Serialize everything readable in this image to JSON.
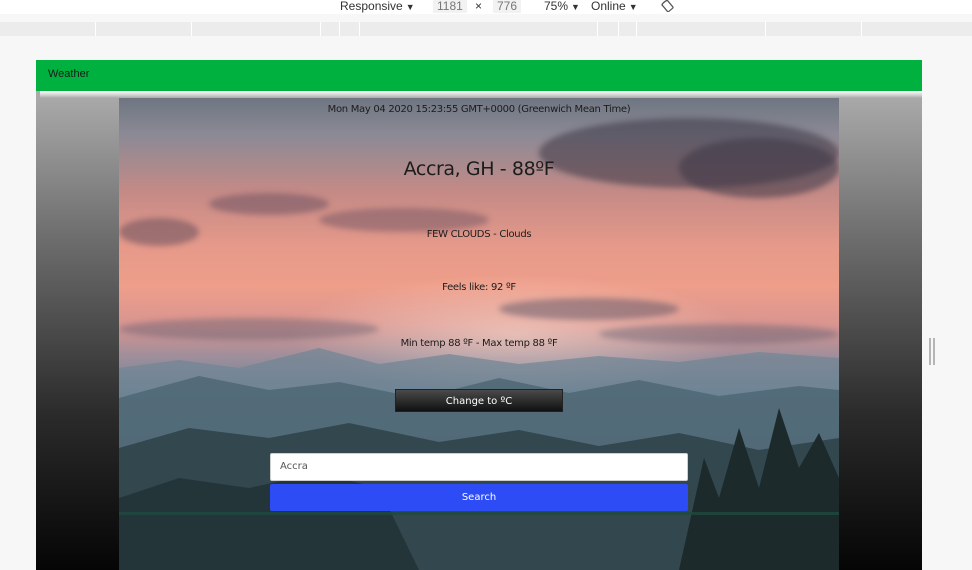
{
  "devtools": {
    "device": "Responsive",
    "width": "1181",
    "times": "×",
    "height": "776",
    "zoom": "75%",
    "network": "Online",
    "icons": [
      "caret-down-icon",
      "rotate-icon",
      "resize-handle-icon"
    ]
  },
  "app": {
    "nav_title": "Weather",
    "colors": {
      "nav": "#00b140",
      "search_button": "#2d4cf5",
      "unit_button": "#1a1a1a"
    }
  },
  "weather": {
    "datetime": "Mon May 04 2020 15:23:55 GMT+0000 (Greenwich Mean Time)",
    "location": "Accra, GH - 88ºF",
    "description": "FEW CLOUDS - Clouds",
    "feels_like": "Feels like: 92 ºF",
    "min_max": "Min temp 88 ºF - Max temp 88 ºF",
    "unit_toggle": "Change to ºC"
  },
  "search": {
    "value": "Accra",
    "button": "Search"
  }
}
